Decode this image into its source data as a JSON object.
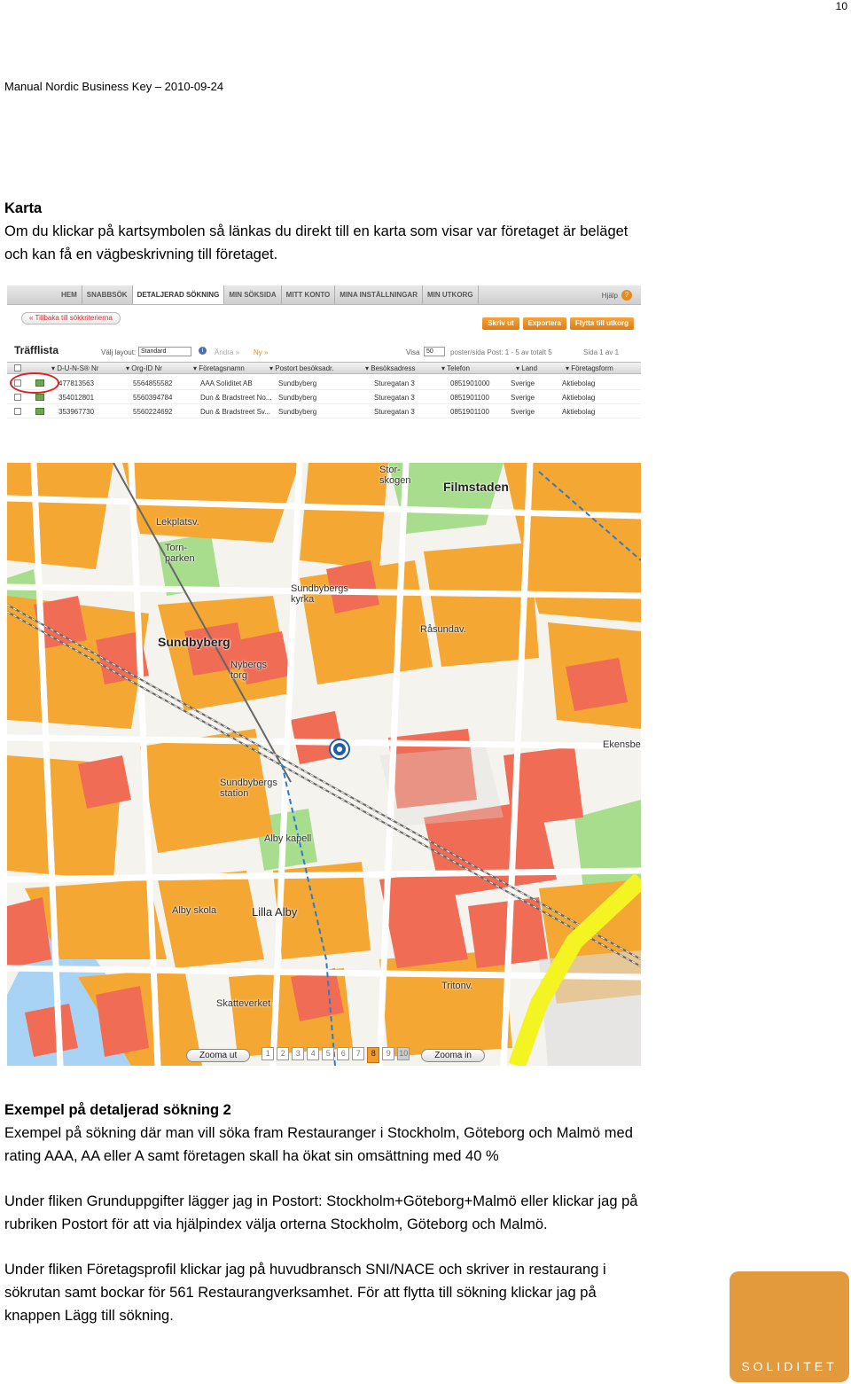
{
  "page_number": "10",
  "header": "Manual Nordic Business Key – 2010-09-24",
  "section_karta": {
    "title": "Karta",
    "body": "Om du klickar på kartsymbolen så länkas du direkt till en karta som visar var företaget är beläget och kan få en vägbeskrivning till företaget."
  },
  "app_screenshot": {
    "nav_tabs": [
      "HEM",
      "SNABBSÖK",
      "DETALJERAD SÖKNING",
      "MIN SÖKSIDA",
      "MITT KONTO",
      "MINA INSTÄLLNINGAR",
      "MIN UTKORG"
    ],
    "active_tab_index": 2,
    "help_label": "Hjälp",
    "back_button": "« Tillbaka till sökkriterierna",
    "actions": [
      "Skriv ut",
      "Exportera",
      "Flytta till utkorg"
    ],
    "list_title": "Träfflista",
    "layout_label": "Välj layout:",
    "layout_value": "Standard",
    "andra_link": "Ändra »",
    "ny_link": "Ny »",
    "visa_label": "Visa",
    "visa_value": "50",
    "post_info": "poster/sida  Post: 1 - 5 av totalt 5",
    "page_info": "Sida 1 av 1",
    "columns": [
      "D-U-N-S® Nr",
      "Org-ID Nr",
      "Företagsnamn",
      "Postort besöksadr.",
      "Besöksadress",
      "Telefon",
      "Land",
      "Företagsform"
    ],
    "rows": [
      [
        "477813563",
        "5564855582",
        "AAA Soliditet AB",
        "Sundbyberg",
        "Sturegatan 3",
        "0851901000",
        "Sverige",
        "Aktiebolag"
      ],
      [
        "354012801",
        "5560394784",
        "Dun & Bradstreet No...",
        "Sundbyberg",
        "Sturegatan 3",
        "0851901100",
        "Sverige",
        "Aktiebolag"
      ],
      [
        "353967730",
        "5560224692",
        "Dun & Bradstreet Sv...",
        "Sundbyberg",
        "Sturegatan 3",
        "0851901100",
        "Sverige",
        "Aktiebolag"
      ]
    ]
  },
  "map_screenshot": {
    "labels": {
      "filmstaden": "Filmstaden",
      "sundbyberg": "Sundbyberg",
      "lilla_alby": "Lilla Alby",
      "storskogen": "Stor-\nskogen",
      "tornparken": "Torn-\nparken",
      "kyrka": "Sundbybergs\nkyrka",
      "station": "Sundbybergs\nstation",
      "alby_kapell": "Alby kapell",
      "alby_skola": "Alby skola",
      "skatteverket": "Skatteverket",
      "ekensberg": "Ekensbe",
      "nybergs_torg": "Nybergs\ntorg",
      "lekplatsv": "Lekplatsv.",
      "rasundav": "Råsundav.",
      "tritonv": "Tritonv."
    },
    "zoom_out": "Zooma ut",
    "zoom_in": "Zooma in",
    "zoom_steps": [
      "1",
      "2",
      "3",
      "4",
      "5",
      "6",
      "7",
      "8",
      "9",
      "10"
    ],
    "zoom_active": "8"
  },
  "section_exempel": {
    "title": "Exempel på detaljerad sökning 2",
    "p1": "Exempel på sökning där man vill söka fram Restauranger i Stockholm, Göteborg och Malmö med rating AAA, AA eller A samt företagen skall ha ökat sin omsättning med 40 %",
    "p2": "Under fliken Grunduppgifter lägger jag in Postort: Stockholm+Göteborg+Malmö eller klickar jag på rubriken Postort för att via hjälpindex välja orterna Stockholm, Göteborg och Malmö.",
    "p3": "Under fliken Företagsprofil klickar jag på huvudbransch SNI/NACE och skriver in restaurang i sökrutan samt bockar för 561 Restaurangverksamhet. För att flytta till sökning klickar jag på knappen Lägg till sökning."
  },
  "logo_text": "SOLIDITET",
  "colors": {
    "map_building_orange": "#f5a733",
    "map_building_red": "#f06c55",
    "map_park_green": "#a8dd8e",
    "map_water_blue": "#a9d3f5",
    "map_road_yellow": "#f4f422",
    "logo_orange": "#e29a3c"
  }
}
